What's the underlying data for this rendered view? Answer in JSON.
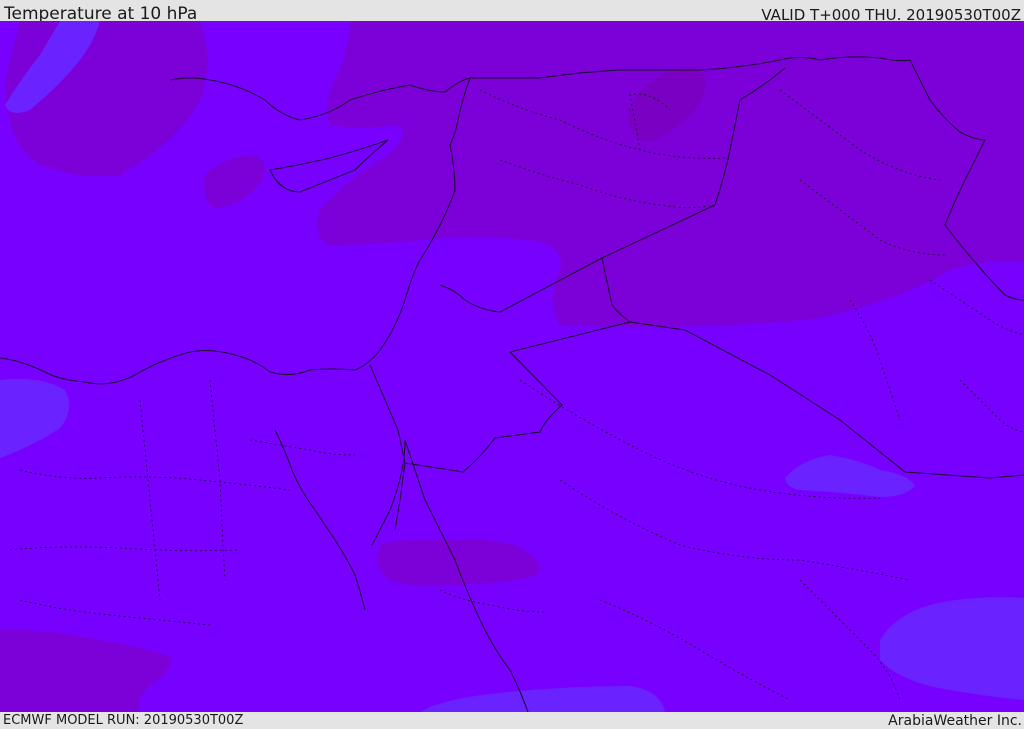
{
  "header": {
    "title": "Temperature at 10 hPa",
    "valid": "VALID T+000 THU. 20190530T00Z"
  },
  "footer": {
    "model_run": "ECMWF MODEL RUN: 20190530T00Z",
    "credit": "ArabiaWeather Inc."
  },
  "map": {
    "variable": "Temperature",
    "level": "10 hPa",
    "base_color": "#7800ff",
    "warm_color": "#7c00d8",
    "warmer_color": "#7a00c4",
    "cool_color": "#6a22ff",
    "border_color": "#1a0a30"
  }
}
